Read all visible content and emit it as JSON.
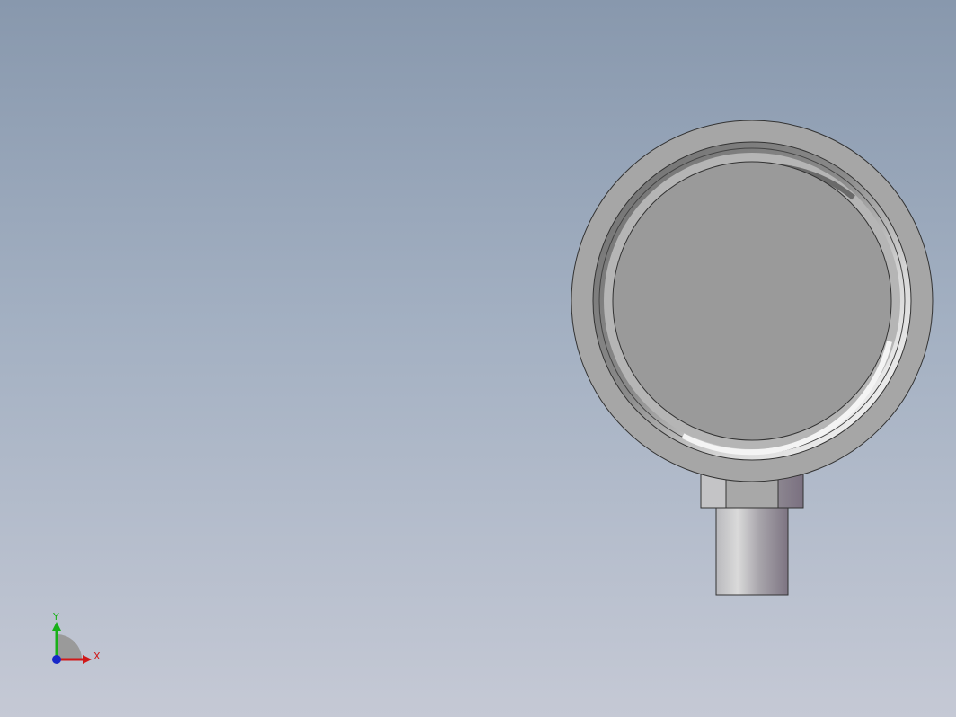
{
  "view": {
    "background_top": "#8898ad",
    "background_bottom": "#c5c9d5"
  },
  "model": {
    "description_icon": "pressure-gauge-part",
    "body_color": "#999999",
    "rim_color": "#a6a6a6"
  },
  "triad": {
    "x_label": "X",
    "y_label": "Y",
    "x_color": "#d01818",
    "y_color": "#18b018",
    "z_color": "#1828c8"
  }
}
